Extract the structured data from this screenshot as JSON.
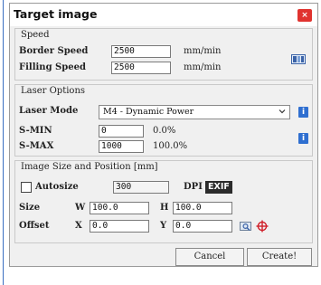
{
  "window": {
    "title": "Target image",
    "close_label": "×"
  },
  "speed": {
    "title": "Speed",
    "border_label": "Border Speed",
    "border_value": "2500",
    "border_unit": "mm/min",
    "filling_label": "Filling Speed",
    "filling_value": "2500",
    "filling_unit": "mm/min",
    "icon": "presets-icon"
  },
  "laser": {
    "title": "Laser Options",
    "mode_label": "Laser Mode",
    "mode_value": "M4 - Dynamic Power",
    "smin_label": "S-MIN",
    "smin_value": "0",
    "smin_percent": "0.0%",
    "smax_label": "S-MAX",
    "smax_value": "1000",
    "smax_percent": "100.0%",
    "info_label": "i"
  },
  "size": {
    "title": "Image Size and Position [mm]",
    "autosize_label": "Autosize",
    "dpi_value": "300",
    "dpi_label": "DPI",
    "exif_label": "EXIF",
    "size_label": "Size",
    "w_label": "W",
    "w_value": "100.0",
    "h_label": "H",
    "h_value": "100.0",
    "offset_label": "Offset",
    "x_label": "X",
    "x_value": "0.0",
    "y_label": "Y",
    "y_value": "0.0"
  },
  "buttons": {
    "cancel": "Cancel",
    "create": "Create!"
  },
  "colors": {
    "accent": "#2f6fd0",
    "close": "#e0332f",
    "target": "#d0202a"
  }
}
